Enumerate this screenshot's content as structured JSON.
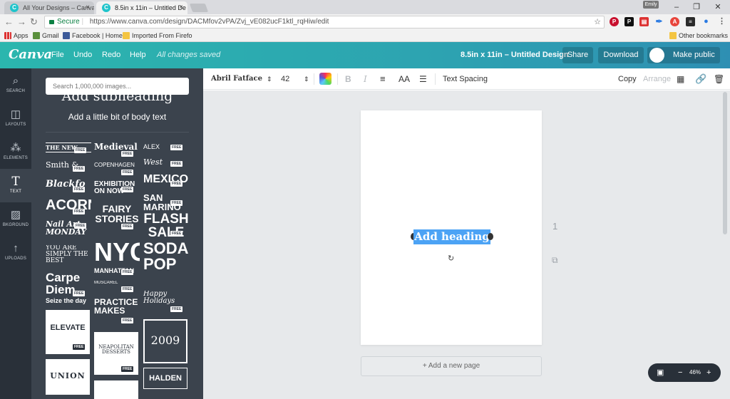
{
  "browser": {
    "tabs": [
      {
        "title": "All Your Designs – Canva",
        "favicon": "C"
      },
      {
        "title": "8.5in x 11in – Untitled De",
        "favicon": "C"
      }
    ],
    "profile": "Emily",
    "secure_label": "Secure",
    "url": "https://www.canva.com/design/DACMfov2vPA/Zvj_vE082ucF1ktl_rqHiw/edit",
    "bookmarks": [
      "Apps",
      "Gmail",
      "Facebook | Home",
      "Imported From Firefo",
      "Other bookmarks"
    ]
  },
  "header": {
    "logo": "Canva",
    "menu": [
      "File",
      "Undo",
      "Redo",
      "Help"
    ],
    "status": "All changes saved",
    "doc_title": "8.5in x 11in – Untitled Design",
    "share": "Share",
    "download": "Download",
    "make_public": "Make public"
  },
  "rail": [
    {
      "label": "SEARCH",
      "icon": "search-icon"
    },
    {
      "label": "LAYOUTS",
      "icon": "layouts-icon"
    },
    {
      "label": "ELEMENTS",
      "icon": "elements-icon"
    },
    {
      "label": "TEXT",
      "icon": "text-icon"
    },
    {
      "label": "BKGROUND",
      "icon": "background-icon"
    },
    {
      "label": "UPLOADS",
      "icon": "upload-icon"
    }
  ],
  "panel": {
    "search_placeholder": "Search 1,000,000 images...",
    "subheading": "Add subheading",
    "body": "Add a little bit of body text",
    "free_badge": "FREE",
    "templates": [
      "THE NEW",
      "Medieval",
      "ALEX",
      "Smith &",
      "COPENHAGEN",
      "West",
      "Blackfo",
      "EXHIBITION ON NOW",
      "MEXICO",
      "ACORN",
      "FAIRY STORIES",
      "SAN MARINO",
      "Nail Art MONDAY",
      "NYC",
      "FLASH SALE",
      "YOU ARE SIMPLY THE BEST",
      "MANHATTAN",
      "SODA-POP",
      "Carpe Diem",
      "MUSCAREL",
      "Happy Holidays",
      "Seize the day",
      "PRACTICE MAKES",
      "ELEVATE",
      "NEAPOLITAN DESSERTS",
      "2009",
      "UNION",
      "HALDEN"
    ]
  },
  "objbar": {
    "font": "Abril Fatface",
    "size": "42",
    "bold": "B",
    "italic": "I",
    "case": "AA",
    "spacing": "Text Spacing",
    "copy": "Copy",
    "arrange": "Arrange"
  },
  "editor": {
    "selected_text": "Add heading",
    "page_number": "1",
    "add_page": "+ Add a new page",
    "zoom": "46%"
  }
}
